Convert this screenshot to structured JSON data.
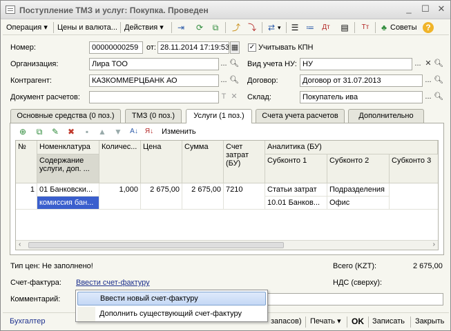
{
  "window": {
    "title": "Поступление ТМЗ и услуг: Покупка. Проведен"
  },
  "toolbar": {
    "operation": "Операция",
    "prices": "Цены и валюта...",
    "actions": "Действия",
    "advice": "Советы"
  },
  "form": {
    "number_label": "Номер:",
    "number_value": "00000000259",
    "from_label": "от:",
    "date_value": "28.11.2014 17:19:53",
    "kpn_label": "Учитывать КПН",
    "org_label": "Организация:",
    "org_value": "Лира ТОО",
    "nu_label": "Вид учета НУ:",
    "nu_value": "НУ",
    "contractor_label": "Контрагент:",
    "contractor_value": "КАЗКОММЕРЦБАНК АО",
    "contract_label": "Договор:",
    "contract_value": "Договор от 31.07.2013",
    "settlement_label": "Документ расчетов:",
    "settlement_value": "",
    "warehouse_label": "Склад:",
    "warehouse_value": "Покупатель ива"
  },
  "tabs": [
    {
      "label": "Основные средства (0 поз.)"
    },
    {
      "label": "ТМЗ (0 поз.)"
    },
    {
      "label": "Услуги (1 поз.)"
    },
    {
      "label": "Счета учета расчетов"
    },
    {
      "label": "Дополнительно"
    }
  ],
  "grid_toolbar": {
    "edit_label": "Изменить"
  },
  "grid": {
    "headers": {
      "num": "№",
      "nomenclature": "Номенклатура",
      "content": "Содержание услуги, доп. ...",
      "qty": "Количес...",
      "price": "Цена",
      "sum": "Сумма",
      "account": "Счет затрат (БУ)",
      "analytics": "Аналитика (БУ)",
      "sub1": "Субконто 1",
      "sub2": "Субконто 2",
      "sub3": "Субконто 3"
    },
    "row": {
      "num": "1",
      "nomenclature": "01 Банковски...",
      "content": "комиссия бан...",
      "qty": "1,000",
      "price": "2 675,00",
      "sum": "2 675,00",
      "account": "7210",
      "sub1a": "Статьи затрат",
      "sub1b": "10.01 Банков...",
      "sub2a": "Подразделения",
      "sub2b": "Офис"
    }
  },
  "footer": {
    "price_type": "Тип цен: Не заполнено!",
    "total_label": "Всего (KZT):",
    "total_value": "2 675,00",
    "invoice_label": "Счет-фактура:",
    "invoice_link": "Ввести счет-фактуру",
    "vat_label": "НДС (сверху):",
    "comment_label": "Комментарий:"
  },
  "context_menu": {
    "items": [
      "Ввести новый счет-фактуру",
      "Дополнить существующий счет-фактуру"
    ]
  },
  "statusbar": {
    "accountant": "Бухгалтер",
    "stock": "запасов)",
    "print": "Печать",
    "ok": "OK",
    "save": "Записать",
    "close": "Закрыть"
  },
  "colors": {
    "selection": "#c4d8f5",
    "link": "#1a2e8c",
    "content_cell": "#3a5fcd"
  }
}
